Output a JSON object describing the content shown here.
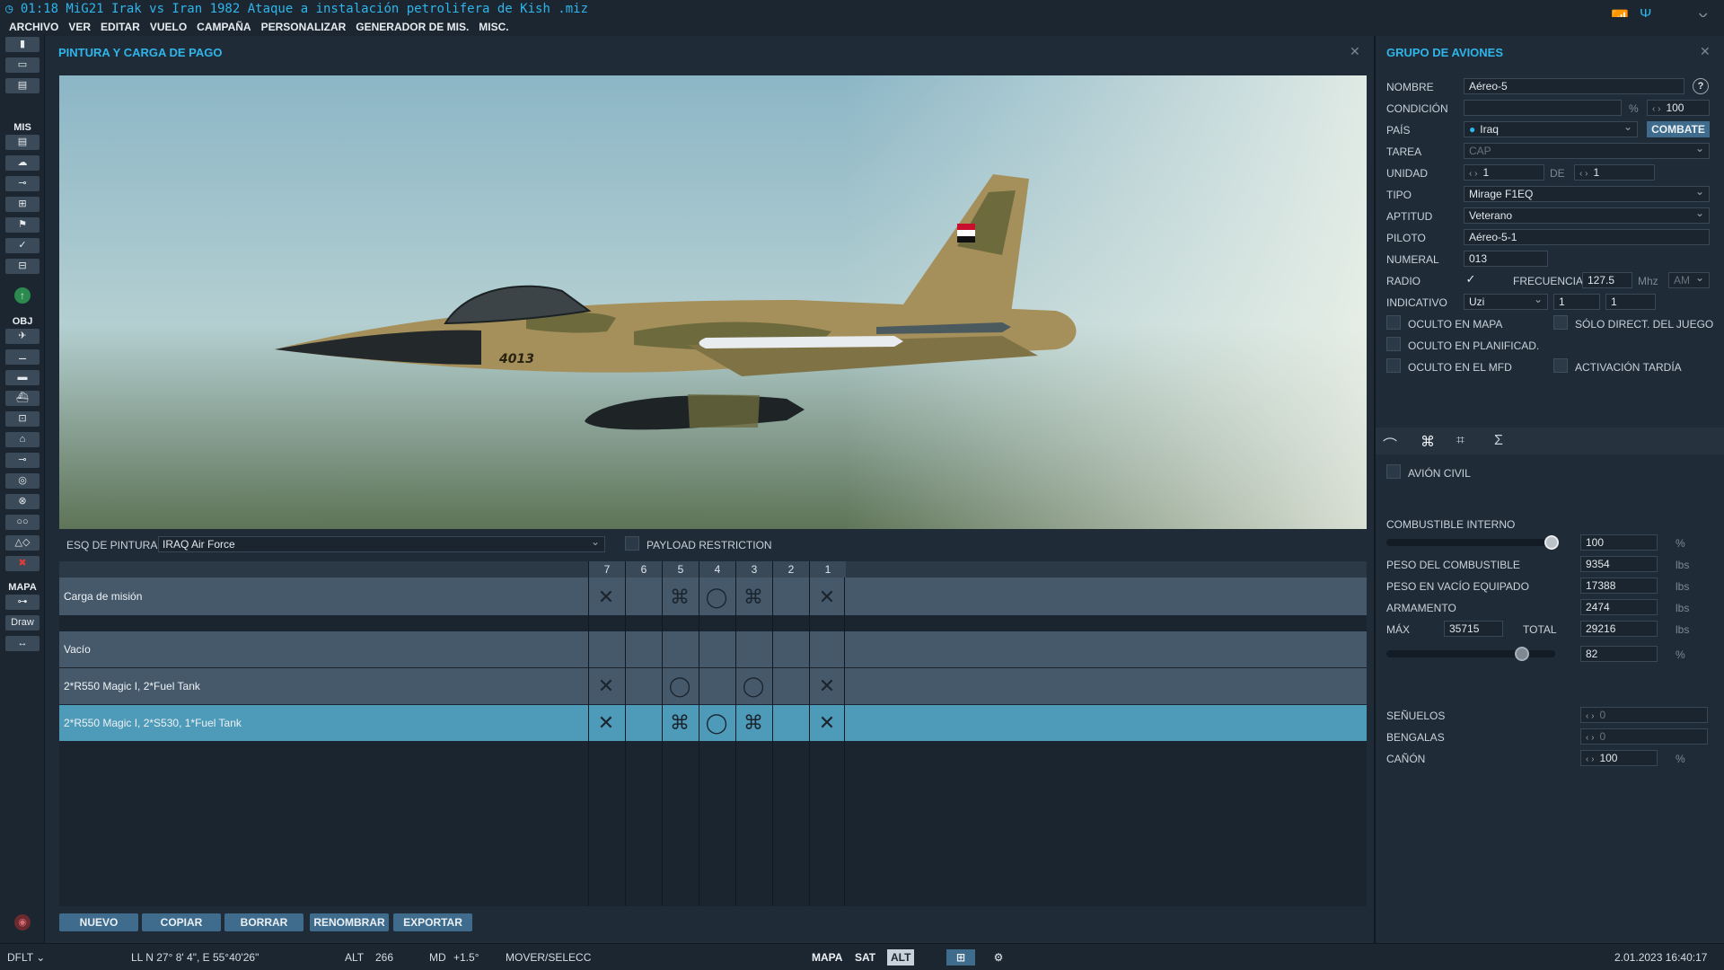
{
  "window": {
    "title": "01:18 MiG21 Irak vs Iran 1982 Ataque a instalación petrolifera de Kish .miz"
  },
  "menu": [
    "ARCHIVO",
    "VER",
    "EDITAR",
    "VUELO",
    "CAMPAÑA",
    "PERSONALIZAR",
    "GENERADOR DE MIS.",
    "MISC."
  ],
  "toolbar": {
    "mis_label": "MIS",
    "obj_label": "OBJ",
    "mapa_label": "MAPA",
    "draw_label": "Draw"
  },
  "paint_panel": {
    "title": "PINTURA Y CARGA DE PAGO",
    "aircraft_tail_number": "4013",
    "paint_label": "ESQ DE PINTURA",
    "paint_value": "IRAQ Air Force",
    "payload_restriction_label": "PAYLOAD RESTRICTION",
    "station_headers": [
      "7",
      "6",
      "5",
      "4",
      "3",
      "2",
      "1"
    ],
    "mission_load_label": "Carga de misión",
    "payloads": [
      {
        "name": "Vacío"
      },
      {
        "name": "2*R550 Magic I, 2*Fuel Tank"
      },
      {
        "name": "2*R550 Magic I, 2*S530, 1*Fuel Tank"
      }
    ],
    "buttons": {
      "new": "NUEVO",
      "copy": "COPIAR",
      "delete": "BORRAR",
      "rename": "RENOMBRAR",
      "export": "EXPORTAR"
    }
  },
  "group_panel": {
    "title": "GRUPO DE AVIONES",
    "name_label": "NOMBRE",
    "name_value": "Aéreo-5",
    "help": "?",
    "condition_label": "CONDICIÓN",
    "condition_unit": "%",
    "condition_value": "100",
    "country_label": "PAÍS",
    "country_value": "Iraq",
    "combat_button": "COMBATE",
    "task_label": "TAREA",
    "task_value": "CAP",
    "unit_label": "UNIDAD",
    "unit_value": "1",
    "unit_of_label": "DE",
    "unit_total": "1",
    "type_label": "TIPO",
    "type_value": "Mirage F1EQ",
    "skill_label": "APTITUD",
    "skill_value": "Veterano",
    "pilot_label": "PILOTO",
    "pilot_value": "Aéreo-5-1",
    "numeral_label": "NUMERAL",
    "numeral_value": "013",
    "radio_label": "RADIO",
    "freq_label": "FRECUENCIA",
    "freq_value": "127.5",
    "freq_unit": "Mhz",
    "modulation": "AM",
    "callsign_label": "INDICATIVO",
    "callsign_value": "Uzi",
    "callsign_n1": "1",
    "callsign_n2": "1",
    "hidden_map": "OCULTO EN MAPA",
    "game_master_only": "SÓLO DIRECT. DEL JUEGO",
    "hidden_planner": "OCULTO EN PLANIFICAD.",
    "hidden_mfd": "OCULTO EN EL MFD",
    "late_activation": "ACTIVACIÓN TARDÍA",
    "civil": "AVIÓN CIVIL",
    "fuel_internal_label": "COMBUSTIBLE INTERNO",
    "fuel_internal_value": "100",
    "fuel_internal_unit": "%",
    "fuel_weight_label": "PESO DEL COMBUSTIBLE",
    "fuel_weight_value": "9354",
    "empty_weight_label": "PESO EN VACÍO EQUIPADO",
    "empty_weight_value": "17388",
    "weapons_label": "ARMAMENTO",
    "weapons_value": "2474",
    "max_label": "MÁX",
    "max_value": "35715",
    "total_label": "TOTAL",
    "total_value": "29216",
    "lbs": "lbs",
    "load_pct_value": "82",
    "load_pct_unit": "%",
    "chaff_label": "SEÑUELOS",
    "chaff_value": "0",
    "flares_label": "BENGALAS",
    "flares_value": "0",
    "gun_label": "CAÑÓN",
    "gun_value": "100",
    "gun_unit": "%"
  },
  "status": {
    "layout": "DFLT",
    "coords": "LL  N 27° 8' 4\", E 55°40'26\"",
    "alt_label": "ALT",
    "alt_value": "266",
    "md_label": "MD",
    "md_value": "+1.5°",
    "mode": "MOVER/SELECC",
    "map_btn": "MAPA",
    "sat_btn": "SAT",
    "alt_btn": "ALT",
    "datetime": "2.01.2023 16:40:17"
  },
  "colors": {
    "accent": "#2fb5ea",
    "selected_row": "#4e9ab9",
    "row": "#46596b"
  }
}
